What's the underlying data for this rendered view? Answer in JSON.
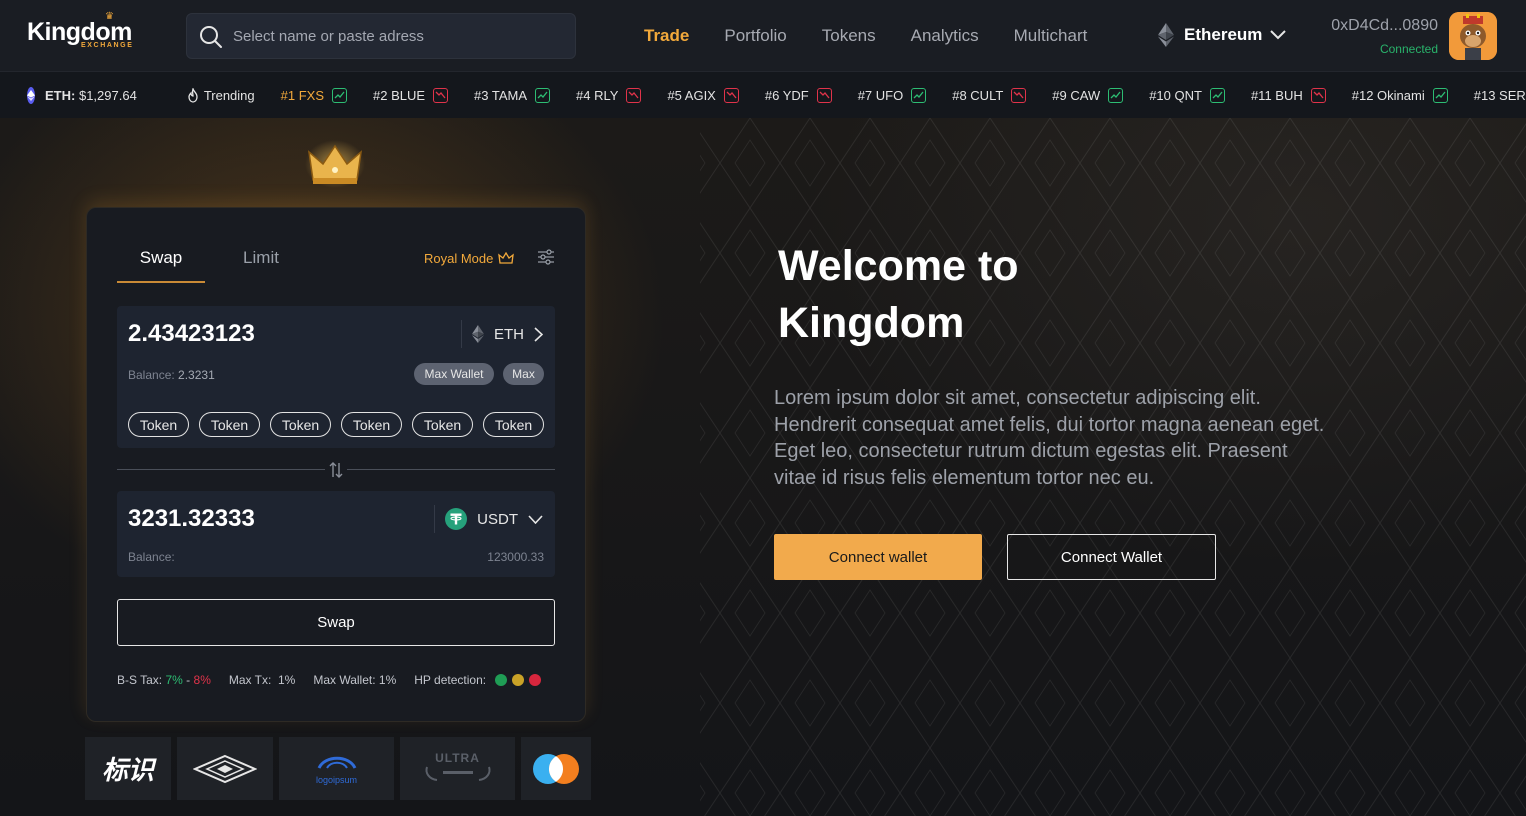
{
  "brand": {
    "name": "Kingdom",
    "sub": "EXCHANGE"
  },
  "search": {
    "placeholder": "Select name or paste adress"
  },
  "nav": [
    {
      "label": "Trade",
      "active": true
    },
    {
      "label": "Portfolio",
      "active": false
    },
    {
      "label": "Tokens",
      "active": false
    },
    {
      "label": "Analytics",
      "active": false
    },
    {
      "label": "Multichart",
      "active": false
    }
  ],
  "network": {
    "label": "Ethereum",
    "icon": "ethereum-icon"
  },
  "wallet": {
    "address": "0xD4Cd...0890",
    "status": "Connected"
  },
  "ticker": {
    "eth_label": "ETH:",
    "eth_price": "$1,297.64",
    "trending_label": "Trending",
    "items": [
      {
        "label": "#1 FXS",
        "trend": "up"
      },
      {
        "label": "#2 BLUE",
        "trend": "down"
      },
      {
        "label": "#3 TAMA",
        "trend": "up"
      },
      {
        "label": "#4 RLY",
        "trend": "down"
      },
      {
        "label": "#5 AGIX",
        "trend": "down"
      },
      {
        "label": "#6 YDF",
        "trend": "down"
      },
      {
        "label": "#7 UFO",
        "trend": "up"
      },
      {
        "label": "#8 CULT",
        "trend": "down"
      },
      {
        "label": "#9 CAW",
        "trend": "up"
      },
      {
        "label": "#10 QNT",
        "trend": "up"
      },
      {
        "label": "#11 BUH",
        "trend": "down"
      },
      {
        "label": "#12 Okinami",
        "trend": "up"
      },
      {
        "label": "#13 SER",
        "trend": "up"
      }
    ]
  },
  "swap": {
    "tab_swap": "Swap",
    "tab_limit": "Limit",
    "royal_mode": "Royal Mode",
    "from": {
      "amount": "2.43423123",
      "token": "ETH",
      "balance_label": "Balance:",
      "balance_value": "2.3231",
      "max_wallet": "Max Wallet",
      "max": "Max",
      "chips": [
        "Token",
        "Token",
        "Token",
        "Token",
        "Token",
        "Token"
      ]
    },
    "to": {
      "amount": "3231.32333",
      "token": "USDT",
      "balance_label": "Balance:",
      "balance_value": "123000.33"
    },
    "button": "Swap",
    "stats": {
      "tax_label": "B-S Tax:",
      "tax_buy": "7%",
      "tax_dash": "-",
      "tax_sell": "8%",
      "max_tx": "Max Tx:  1%",
      "max_wallet": "Max Wallet: 1%",
      "hp_label": "HP detection:"
    }
  },
  "partners": [
    {
      "name": "partner-logo-1",
      "text": "标识"
    },
    {
      "name": "partner-logo-2",
      "text": ""
    },
    {
      "name": "partner-logo-3",
      "text": "logoipsum"
    },
    {
      "name": "partner-logo-4",
      "text": "ULTRA"
    },
    {
      "name": "partner-logo-5",
      "text": ""
    }
  ],
  "welcome": {
    "title": "Welcome to Kingdom",
    "body": "Lorem ipsum dolor sit amet, consectetur adipiscing elit. Hendrerit consequat amet felis, dui tortor magna aenean eget. Eget leo, consectetur rutrum dictum egestas elit. Praesent vitae id risus felis elementum tortor nec eu.",
    "btn_primary": "Connect wallet",
    "btn_secondary": "Connect Wallet"
  },
  "colors": {
    "accent": "#f2a93b",
    "up": "#2dbd73",
    "down": "#e0334a",
    "panel": "#1e2430",
    "background": "#121418"
  }
}
